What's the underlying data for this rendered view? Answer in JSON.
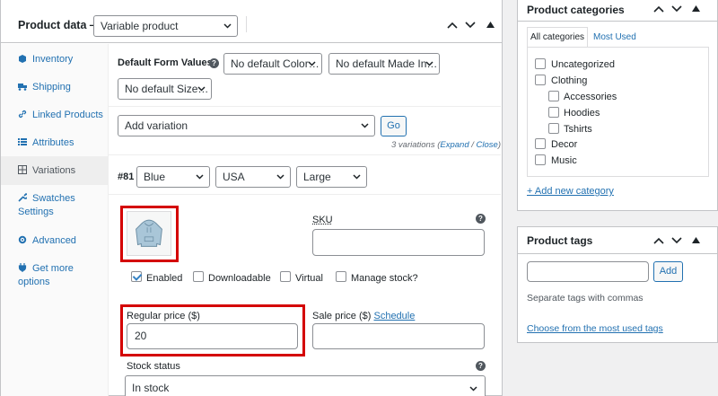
{
  "product_data": {
    "title": "Product data —",
    "product_type": "Variable product",
    "tabs": [
      {
        "label": "Inventory",
        "icon": "inventory-icon"
      },
      {
        "label": "Shipping",
        "icon": "truck-icon"
      },
      {
        "label": "Linked Products",
        "icon": "link-icon"
      },
      {
        "label": "Attributes",
        "icon": "list-icon"
      },
      {
        "label": "Variations",
        "icon": "grid-icon"
      },
      {
        "label": "Swatches",
        "label2": "Settings",
        "icon": "wrench-icon"
      },
      {
        "label": "Advanced",
        "icon": "gear-icon"
      },
      {
        "label": "Get more",
        "label2": "options",
        "icon": "plugin-icon"
      }
    ],
    "default_form_values_label": "Default Form Values:",
    "defaults": [
      "No default Color…",
      "No default Made In…",
      "No default Size…"
    ],
    "add_variation": "Add variation",
    "go_label": "Go",
    "variations_count": "3 variations (",
    "expand": "Expand",
    "close": "Close",
    "sep": " / ",
    "close_paren": ")",
    "variation": {
      "id": "#81",
      "color": "Blue",
      "made_in": "USA",
      "size": "Large",
      "sku_label": "SKU",
      "sku_value": "",
      "enabled_label": "Enabled",
      "downloadable_label": "Downloadable",
      "virtual_label": "Virtual",
      "manage_stock_label": "Manage stock?",
      "regular_price_label": "Regular price ($)",
      "regular_price_value": "20",
      "sale_price_label": "Sale price ($)",
      "schedule_label": "Schedule",
      "sale_price_value": "",
      "stock_status_label": "Stock status",
      "stock_status_value": "In stock"
    }
  },
  "categories": {
    "title": "Product categories",
    "tab_all": "All categories",
    "tab_most_used": "Most Used",
    "items": [
      {
        "label": "Uncategorized",
        "level": 0
      },
      {
        "label": "Clothing",
        "level": 0
      },
      {
        "label": "Accessories",
        "level": 1
      },
      {
        "label": "Hoodies",
        "level": 1
      },
      {
        "label": "Tshirts",
        "level": 1
      },
      {
        "label": "Decor",
        "level": 0
      },
      {
        "label": "Music",
        "level": 0
      }
    ],
    "add_new": "+ Add new category"
  },
  "tags": {
    "title": "Product tags",
    "add_label": "Add",
    "hint": "Separate tags with commas",
    "choose_link": "Choose from the most used tags"
  },
  "colors": {
    "accent": "#2271b1",
    "highlight": "#d40000"
  }
}
